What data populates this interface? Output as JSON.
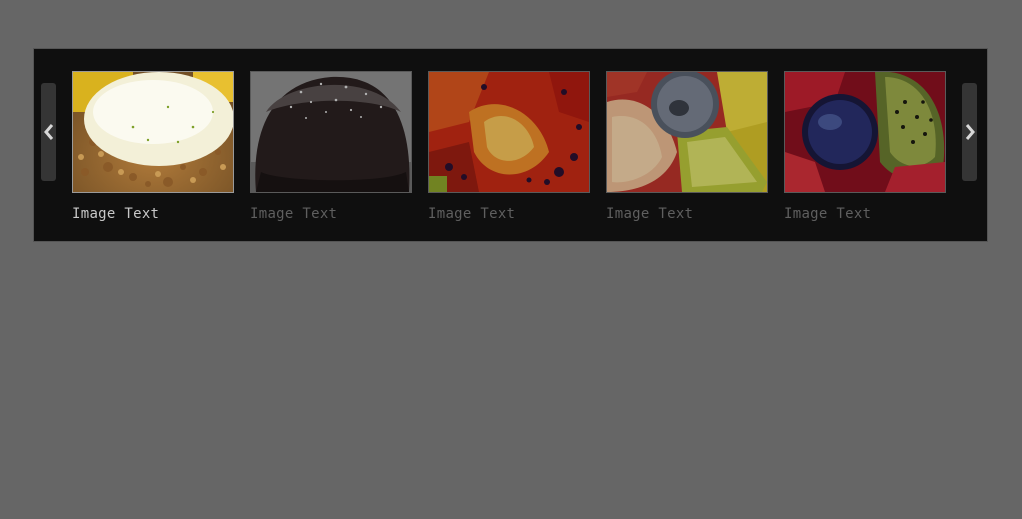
{
  "carousel": {
    "prev_icon": "chevron-left-icon",
    "next_icon": "chevron-right-icon",
    "active_index": 0,
    "items": [
      {
        "caption": "Image Text",
        "image": "dessert-cream-crumble"
      },
      {
        "caption": "Image Text",
        "image": "chocolate-cake-sugar"
      },
      {
        "caption": "Image Text",
        "image": "red-fruit-tart"
      },
      {
        "caption": "Image Text",
        "image": "fruit-salad-blueberry"
      },
      {
        "caption": "Image Text",
        "image": "kiwi-blueberry-strawberry"
      }
    ]
  },
  "colors": {
    "page_background": "#666666",
    "panel_background": "#0f0f0f",
    "caption_active": "#c8c8c8",
    "caption_inactive": "#5f5f5f",
    "arrow_background": "#353535"
  }
}
